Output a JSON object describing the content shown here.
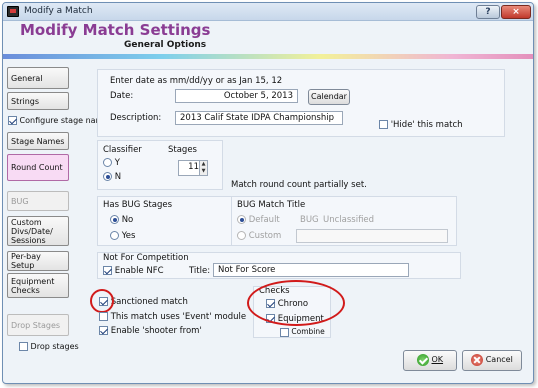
{
  "window": {
    "title": "Modify a Match",
    "help_label": "?",
    "close_label": "×"
  },
  "header": {
    "title": "Modify Match Settings",
    "subtitle": "General Options"
  },
  "sidebar": {
    "general": "General",
    "strings": "Strings",
    "configure_stage_names": "Configure stage names",
    "stage_names": "Stage Names",
    "round_count": "Round Count",
    "bug": "BUG",
    "custom_divs": "Custom Divs/Date/ Sessions",
    "per_bay_setup": "Per-bay Setup",
    "equipment_checks": "Equipment Checks",
    "drop_stages": "Drop Stages",
    "drop_stages_checkbox": "Drop stages"
  },
  "date_section": {
    "hint": "Enter date as mm/dd/yy or as Jan 15, 12",
    "date_label": "Date:",
    "date_value": "October 5, 2013",
    "calendar_button": "Calendar",
    "description_label": "Description:",
    "description_value": "2013 Calif State IDPA Championship",
    "hide_label": "'Hide' this match"
  },
  "classifier": {
    "label": "Classifier",
    "yes": "Y",
    "no": "N"
  },
  "stages": {
    "label": "Stages",
    "value": "11"
  },
  "round_count_status": "Match round count partially set.",
  "bug_stages": {
    "label": "Has BUG Stages",
    "no": "No",
    "yes": "Yes"
  },
  "bug_match_title": {
    "label": "BUG Match Title",
    "default": "Default",
    "bug": "BUG",
    "unclassified": "Unclassified",
    "custom": "Custom",
    "custom_value": ""
  },
  "competition": {
    "label": "Not For Competition",
    "enable_nfc": "Enable NFC",
    "title_label": "Title:",
    "title_value": "Not For Score"
  },
  "options": {
    "sanctioned": "Sanctioned match",
    "event_module": "This match uses 'Event' module",
    "shooter_from": "Enable 'shooter from'"
  },
  "checks": {
    "label": "Checks",
    "chrono": "Chrono",
    "equipment": "Equipment",
    "combine": "Combine"
  },
  "footer": {
    "ok": "OK",
    "cancel": "Cancel"
  }
}
